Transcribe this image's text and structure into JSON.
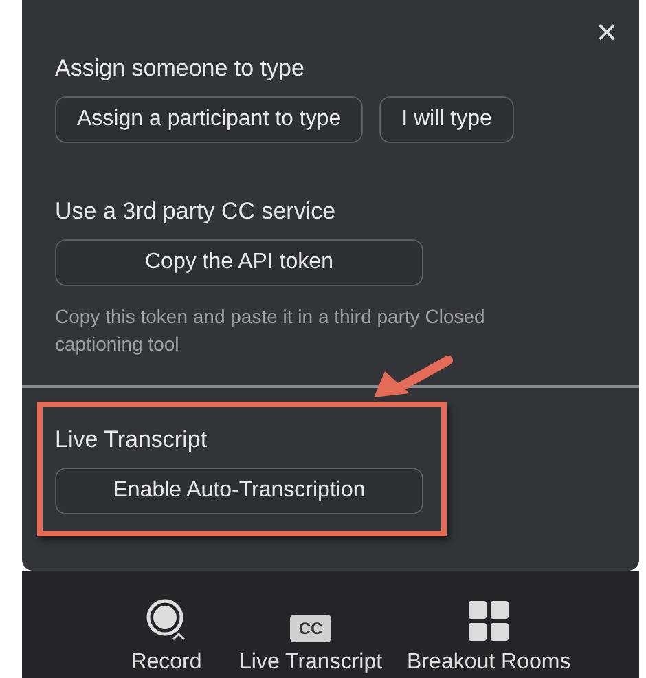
{
  "dialog": {
    "close": "×",
    "sections": [
      {
        "title": "Assign someone to type",
        "buttons": [
          "Assign a participant to type",
          "I will type"
        ]
      },
      {
        "title": "Use a 3rd party CC service",
        "buttons": [
          "Copy the API token"
        ],
        "note": "Copy this token and paste it in a third party Closed captioning tool"
      }
    ],
    "live_section": {
      "title": "Live Transcript",
      "buttons": [
        "Enable Auto-Transcription"
      ],
      "highlighted": true
    }
  },
  "toolbar": [
    {
      "kind": "record",
      "label": "Record"
    },
    {
      "kind": "cc",
      "label": "Live Transcript",
      "badge": "CC"
    },
    {
      "kind": "grid",
      "label": "Breakout Rooms"
    }
  ]
}
